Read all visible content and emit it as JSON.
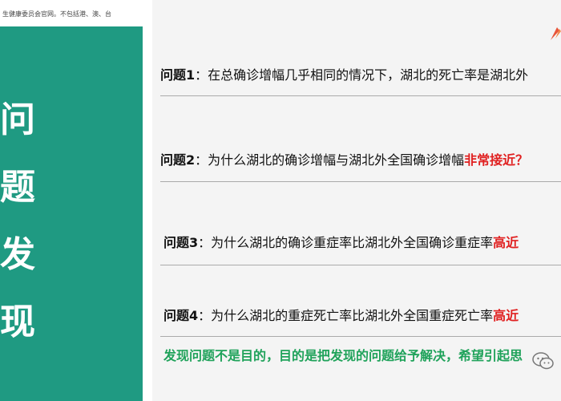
{
  "source_note": "生健康委员会官网。不包括港、澳、台",
  "side_title": [
    "问",
    "题",
    "发",
    "现"
  ],
  "questions": [
    {
      "no": "问题1",
      "colon": "：",
      "text": "在总确诊增幅几乎相同的情况下，湖北的死亡率是湖北外",
      "highlight": ""
    },
    {
      "no": "问题2",
      "colon": "：",
      "text": "为什么湖北的确诊增幅与湖北外全国确诊增幅",
      "highlight": "非常接近？"
    },
    {
      "no": "问题3",
      "colon": "：",
      "text": "为什么湖北的确诊重症率比湖北外全国确诊重症率",
      "highlight": "高近"
    },
    {
      "no": "问题4",
      "colon": "：",
      "text": "为什么湖北的重症死亡率比湖北外全国重症死亡率",
      "highlight": "高近"
    }
  ],
  "conclusion": "发现问题不是目的，目的是把发现的问题给予解决，希望引起思",
  "icons": {
    "wechat": "wechat-icon",
    "deco": "red-arrow-icon"
  },
  "colors": {
    "panel": "#1f9a82",
    "highlight": "#e02020",
    "conclusion": "#1fa25a"
  }
}
